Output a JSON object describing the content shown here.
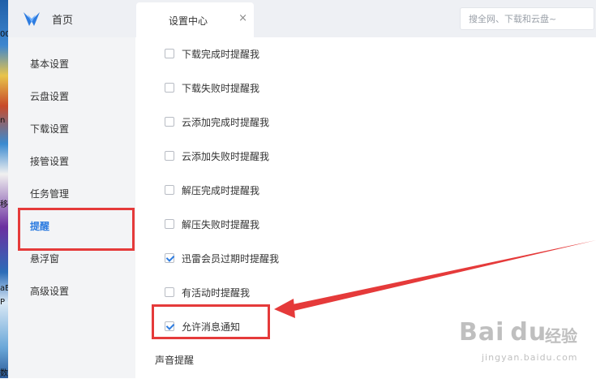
{
  "desktop": {
    "fragments": [
      "00",
      "移",
      "n",
      "aE",
      "P",
      "数"
    ]
  },
  "header": {
    "home_label": "首页",
    "tab_label": "设置中心",
    "tab_close": "×",
    "search_placeholder": "搜全网、下载和云盘~",
    "search_value": ""
  },
  "sidebar": {
    "items": [
      {
        "label": "基本设置"
      },
      {
        "label": "云盘设置"
      },
      {
        "label": "下载设置"
      },
      {
        "label": "接管设置"
      },
      {
        "label": "任务管理"
      },
      {
        "label": "提醒",
        "active": true
      },
      {
        "label": "悬浮窗"
      },
      {
        "label": "高级设置"
      }
    ]
  },
  "options": [
    {
      "label": "下载完成时提醒我",
      "checked": false
    },
    {
      "label": "下载失败时提醒我",
      "checked": false
    },
    {
      "label": "云添加完成时提醒我",
      "checked": false
    },
    {
      "label": "云添加失败时提醒我",
      "checked": false
    },
    {
      "label": "解压完成时提醒我",
      "checked": false
    },
    {
      "label": "解压失败时提醒我",
      "checked": false
    },
    {
      "label": "迅雷会员过期时提醒我",
      "checked": true
    },
    {
      "label": "有活动时提醒我",
      "checked": false
    },
    {
      "label": "允许消息通知",
      "checked": true
    }
  ],
  "sound_section_title": "声音提醒",
  "watermark": {
    "brand": "Bai du",
    "brand_cn": "经验",
    "url": "jingyan.baidu.com"
  },
  "colors": {
    "accent": "#2d7ce0",
    "highlight": "#e53a3a",
    "sidebar_bg": "#f3f4f6",
    "topbar_bg": "#eef0f4"
  }
}
